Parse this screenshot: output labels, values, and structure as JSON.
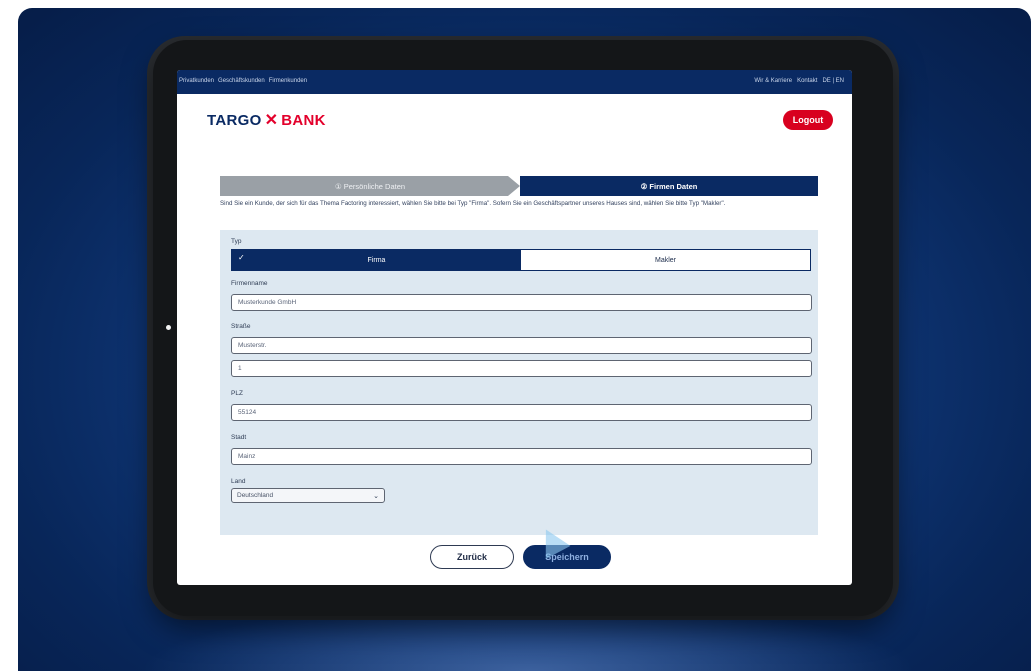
{
  "nav": {
    "left": [
      "Privatkunden",
      "Geschäftskunden",
      "Firmenkunden"
    ],
    "right": [
      "Wir & Karriere",
      "Kontakt",
      "DE | EN"
    ]
  },
  "brand": {
    "left": "TARGO",
    "mark": "✕",
    "right": "BANK"
  },
  "header": {
    "logout": "Logout"
  },
  "steps": {
    "step1": "① Persönliche Daten",
    "step2": "② Firmen Daten"
  },
  "intro": "Sind Sie ein Kunde, der sich für das Thema Factoring interessiert, wählen Sie bitte bei Typ \"Firma\". Sofern Sie ein Geschäftspartner unseres Hauses sind, wählen Sie bitte Typ \"Makler\".",
  "form": {
    "type_label": "Typ",
    "type_selected_check": "✓",
    "type_firma": "Firma",
    "type_makler": "Makler",
    "firmenname_label": "Firmenname",
    "firmenname": "Musterkunde GmbH",
    "strasse_label": "Straße",
    "strasse": "Musterstr.",
    "hausnummer": "1",
    "plz_label": "PLZ",
    "plz": "55124",
    "stadt_label": "Stadt",
    "stadt": "Mainz",
    "land_label": "Land",
    "land": "Deutschland"
  },
  "buttons": {
    "back": "Zurück",
    "save": "Speichern"
  },
  "colors": {
    "navy": "#0a2a63",
    "red": "#d8001f",
    "form_bg": "#dde8f1"
  }
}
